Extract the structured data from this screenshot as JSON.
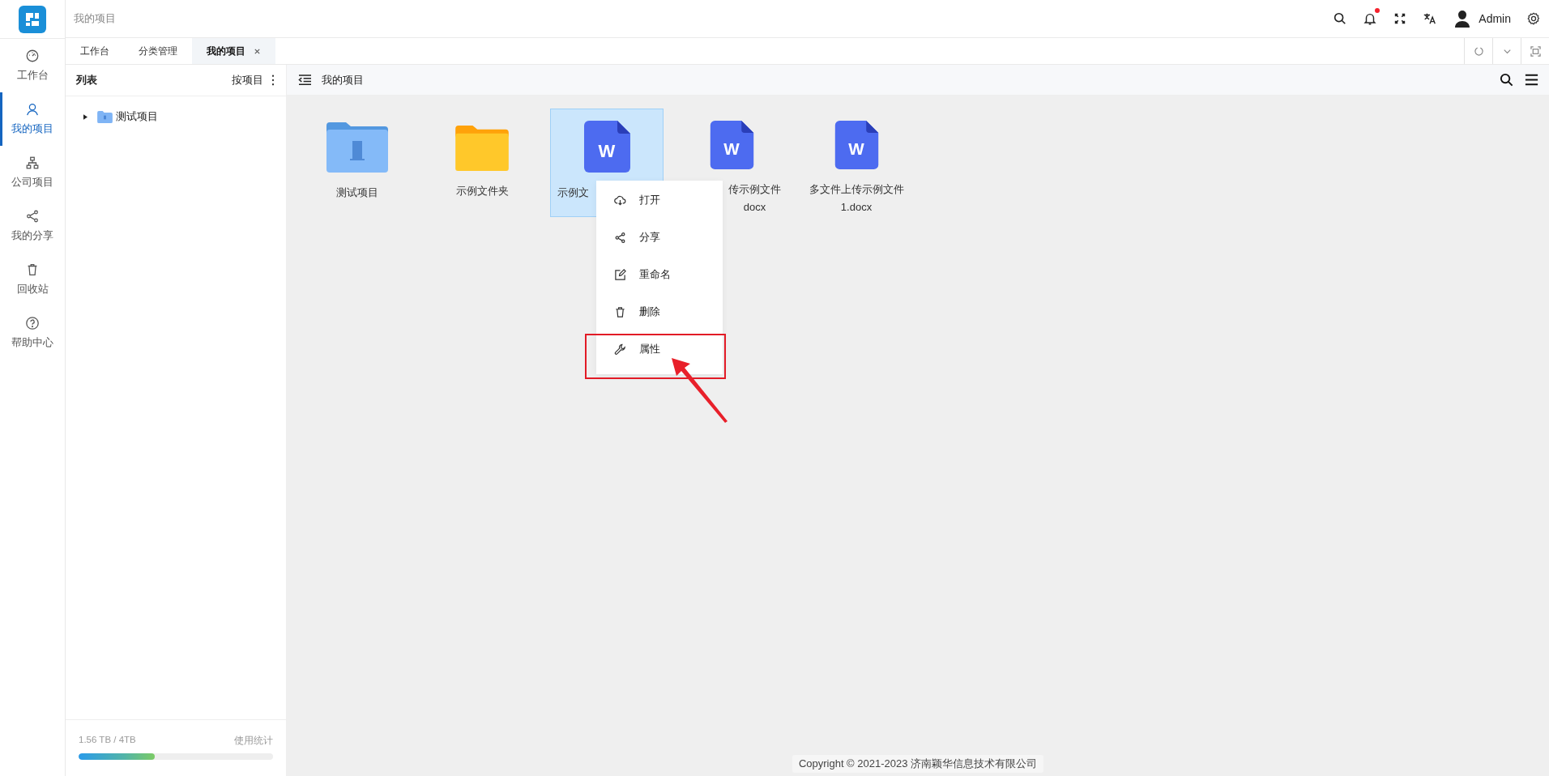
{
  "header": {
    "title": "我的项目",
    "has_unread": true,
    "user": "Admin"
  },
  "nav": [
    {
      "kind": "dashboard",
      "label": "工作台",
      "selected": false
    },
    {
      "kind": "user",
      "label": "我的项目",
      "selected": true
    },
    {
      "kind": "org",
      "label": "公司项目",
      "selected": false
    },
    {
      "kind": "share",
      "label": "我的分享",
      "selected": false
    },
    {
      "kind": "trash",
      "label": "回收站",
      "selected": false
    },
    {
      "kind": "help",
      "label": "帮助中心",
      "selected": false
    }
  ],
  "tabs": [
    {
      "label": "工作台",
      "selected": false,
      "closable": false
    },
    {
      "label": "分类管理",
      "selected": false,
      "closable": false
    },
    {
      "label": "我的项目",
      "selected": true,
      "closable": true
    }
  ],
  "panel": {
    "title": "列表",
    "group_by": "按项目",
    "tree": [
      {
        "label": "测试项目",
        "expanded": false
      }
    ],
    "storage": {
      "usage": "1.56 TB / 4TB",
      "link": "使用统计",
      "level": 0.39
    }
  },
  "main": {
    "title": "我的项目",
    "files": [
      {
        "kind": "project",
        "label_lines": [
          "测试项目"
        ],
        "selected": false
      },
      {
        "kind": "folder",
        "label_lines": [
          "示例文件夹"
        ],
        "selected": false
      },
      {
        "kind": "word",
        "mark": "W",
        "label_lines": [
          "示例文"
        ],
        "selected": true,
        "covered_right": true
      },
      {
        "kind": "word",
        "mark": "W",
        "label_lines": [
          "传示例文件",
          "docx"
        ],
        "selected": false,
        "covered_left": true
      },
      {
        "kind": "word",
        "mark": "W",
        "label_lines": [
          "多文件上传示例文件",
          "1.docx"
        ],
        "selected": false
      }
    ]
  },
  "context_menu": {
    "items": [
      {
        "kind": "open",
        "label": "打开",
        "highlighted": false
      },
      {
        "kind": "share",
        "label": "分享",
        "highlighted": false
      },
      {
        "kind": "rename",
        "label": "重命名",
        "highlighted": false
      },
      {
        "kind": "delete",
        "label": "删除",
        "highlighted": false
      },
      {
        "kind": "properties",
        "label": "属性",
        "highlighted": true
      }
    ]
  },
  "footer": "Copyright © 2021-2023 济南颖华信息技术有限公司"
}
